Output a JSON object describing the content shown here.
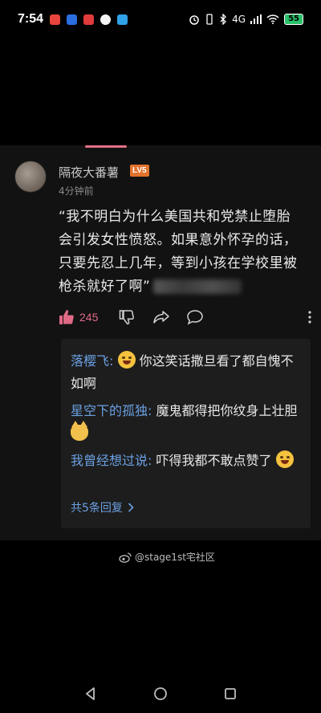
{
  "status_bar": {
    "time": "7:54",
    "network": "4G",
    "battery": "55",
    "app_icons": [
      "#e8453c",
      "#2a6ee0",
      "#e23b3b",
      "#f5f5f5",
      "#2fa1e8"
    ]
  },
  "comment": {
    "username": "隔夜大番薯",
    "level": "LV5",
    "time_ago": "4分钟前",
    "text": "“我不明白为什么美国共和党禁止堕胎会引发女性愤怒。如果意外怀孕的话，只要先忍上几年，等到小孩在学校里被枪杀就好了啊”",
    "like_count": "245",
    "accent_color": "#e06a86"
  },
  "replies": {
    "items": [
      {
        "name": "落樱飞:",
        "text_after_emoji": "你这笑话撒旦看了都自愧不如啊",
        "emoji": "laughing-emoji"
      },
      {
        "name": "星空下的孤独:",
        "text_before_emoji": "魔鬼都得把你纹身上壮胆",
        "emoji": "cat-emoji"
      },
      {
        "name": "我曾经想过说:",
        "text_before_emoji": "吓得我都不敢点赞了",
        "emoji": "tears-of-joy-emoji"
      }
    ],
    "view_all": "共5条回复"
  },
  "watermark": "@stage1st宅社区"
}
